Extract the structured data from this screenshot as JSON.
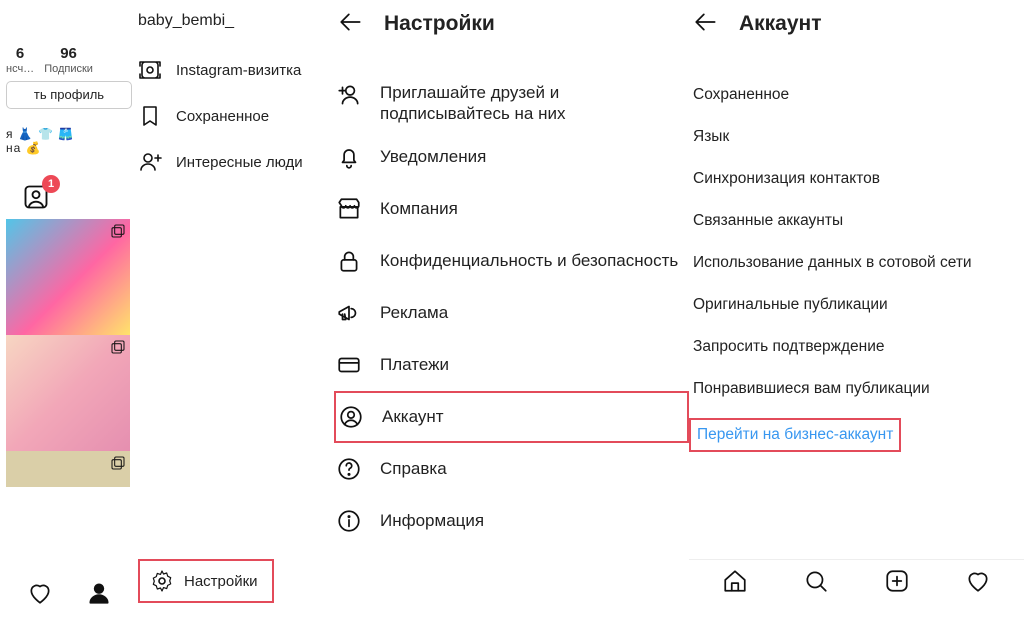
{
  "profile": {
    "username": "baby_bembi_",
    "stat1_num": "6",
    "stat1_lbl": "нсч…",
    "stat2_num": "96",
    "stat2_lbl": "Подписки",
    "edit_btn": "ть профиль",
    "emoji_line1": "я 👗 👕 🩳",
    "emoji_line2": "на 💰",
    "tag_badge": "1"
  },
  "drawer": {
    "i0": "Instagram-визитка",
    "i1": "Сохраненное",
    "i2": "Интересные люди",
    "settings": "Настройки"
  },
  "settings": {
    "title": "Настройки",
    "s0a": "Приглашайте друзей и",
    "s0b": "подписывайтесь на них",
    "s1": "Уведомления",
    "s2": "Компания",
    "s3": "Конфиденциальность и безопасность",
    "s4": "Реклама",
    "s5": "Платежи",
    "s6": "Аккаунт",
    "s7": "Справка",
    "s8": "Информация"
  },
  "account": {
    "title": "Аккаунт",
    "a0": "Сохраненное",
    "a1": "Язык",
    "a2": "Синхронизация контактов",
    "a3": "Связанные аккаунты",
    "a4": "Использование данных в сотовой сети",
    "a5": "Оригинальные публикации",
    "a6": "Запросить подтверждение",
    "a7": "Понравившиеся вам публикации",
    "switch": "Перейти на бизнес-аккаунт"
  }
}
